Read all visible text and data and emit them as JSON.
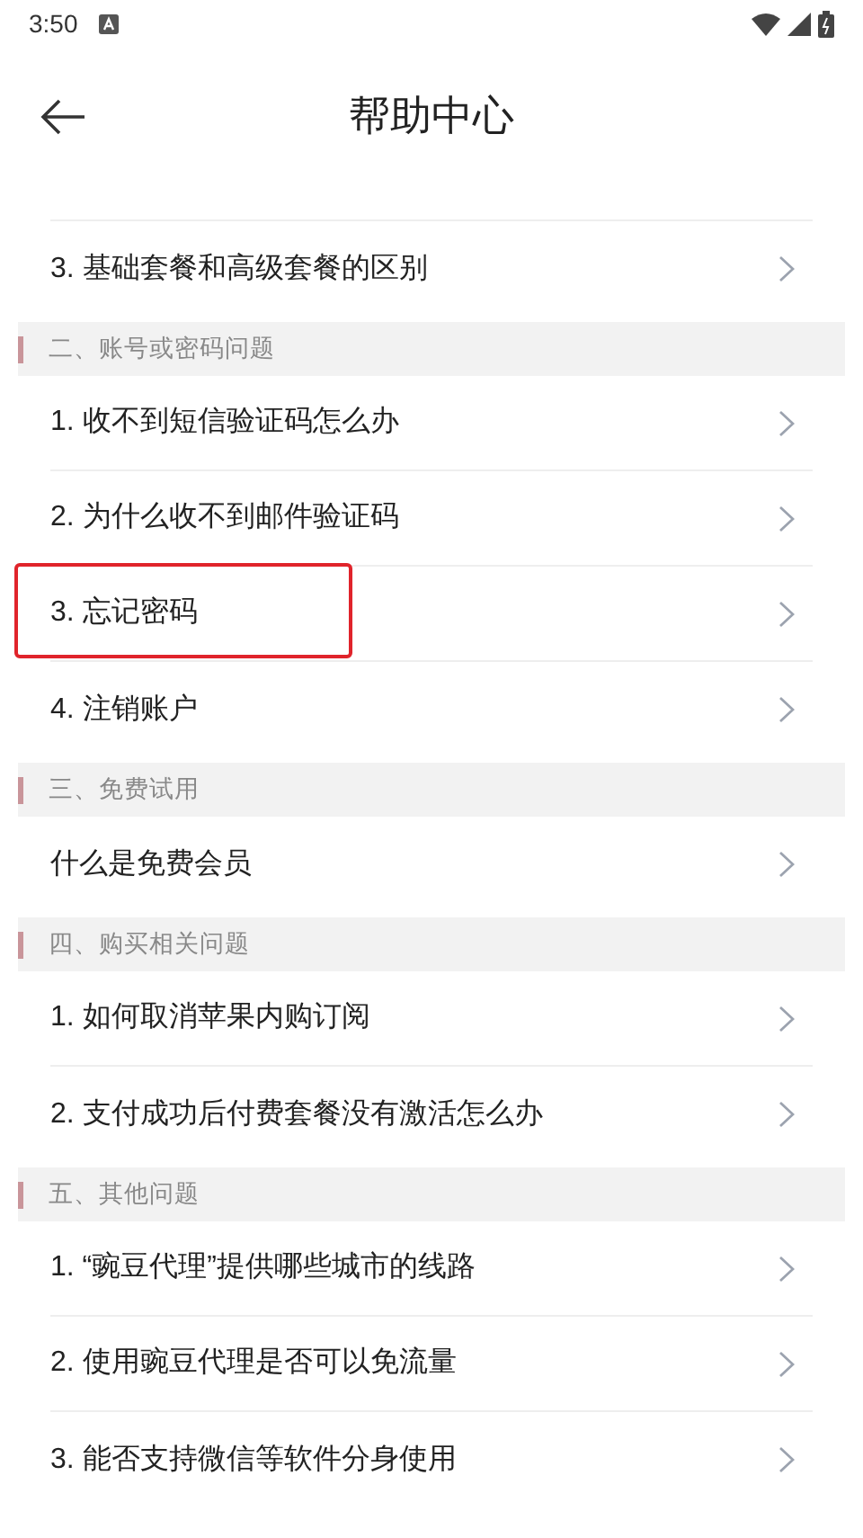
{
  "status_bar": {
    "time": "3:50"
  },
  "header": {
    "title": "帮助中心"
  },
  "sections": [
    {
      "items": [
        {
          "label": "3. 基础套餐和高级套餐的区别",
          "highlighted": false
        }
      ]
    },
    {
      "title": "二、账号或密码问题",
      "items": [
        {
          "label": "1. 收不到短信验证码怎么办",
          "highlighted": false
        },
        {
          "label": "2. 为什么收不到邮件验证码",
          "highlighted": false
        },
        {
          "label": "3. 忘记密码",
          "highlighted": true
        },
        {
          "label": "4. 注销账户",
          "highlighted": false
        }
      ]
    },
    {
      "title": "三、免费试用",
      "items": [
        {
          "label": "什么是免费会员",
          "highlighted": false
        }
      ]
    },
    {
      "title": "四、购买相关问题",
      "items": [
        {
          "label": "1. 如何取消苹果内购订阅",
          "highlighted": false
        },
        {
          "label": "2. 支付成功后付费套餐没有激活怎么办",
          "highlighted": false
        }
      ]
    },
    {
      "title": "五、其他问题",
      "items": [
        {
          "label": "1. “豌豆代理”提供哪些城市的线路",
          "highlighted": false
        },
        {
          "label": "2. 使用豌豆代理是否可以免流量",
          "highlighted": false
        },
        {
          "label": "3. 能否支持微信等软件分身使用",
          "highlighted": false
        }
      ]
    }
  ]
}
